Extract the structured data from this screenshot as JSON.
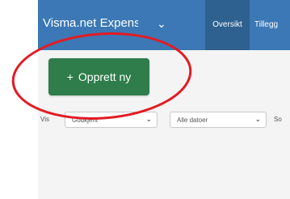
{
  "header": {
    "app_title": "Visma.net Expense",
    "nav_tabs": [
      {
        "label": "Oversikt",
        "active": true
      },
      {
        "label": "Tillegg",
        "active": false
      }
    ]
  },
  "main": {
    "create_button": {
      "icon": "+",
      "label": "Opprett ny"
    }
  },
  "filters": {
    "show_label": "Vis",
    "status": {
      "selected": "Godkjent"
    },
    "dates": {
      "selected": "Alle datoer"
    },
    "sort_label": "So"
  },
  "annotation": {
    "shape": "ellipse",
    "color": "#e31b23"
  },
  "colors": {
    "header_bg": "#3b78b5",
    "active_tab_bg": "#2e618f",
    "primary_button": "#2e7d4a",
    "content_bg": "#f4f4f4"
  }
}
